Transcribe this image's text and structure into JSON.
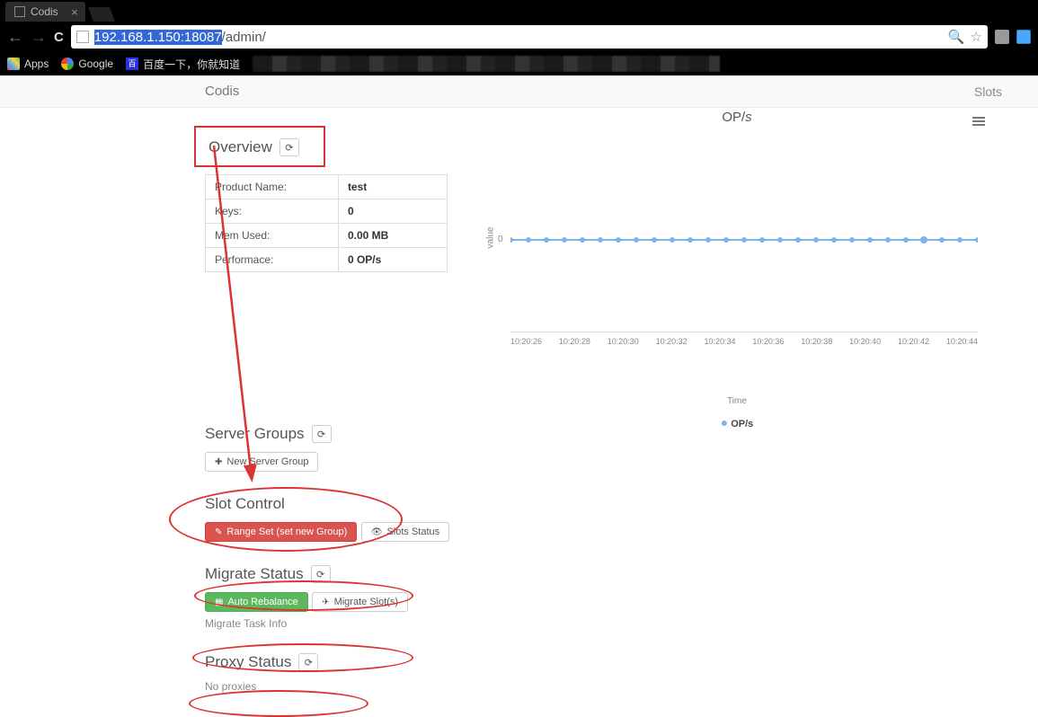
{
  "browser": {
    "tab_title": "Codis",
    "url_selected": "192.168.1.150:18087",
    "url_rest": "/admin/",
    "bookmarks": {
      "apps": "Apps",
      "google": "Google",
      "baidu": "百度一下，你就知道"
    }
  },
  "nav": {
    "brand": "Codis",
    "slots": "Slots"
  },
  "overview": {
    "title": "Overview",
    "rows": [
      {
        "label": "Product Name:",
        "value": "test"
      },
      {
        "label": "Keys:",
        "value": "0"
      },
      {
        "label": "Mem Used:",
        "value": "0.00 MB"
      },
      {
        "label": "Performace:",
        "value": "0 OP/s"
      }
    ]
  },
  "server_groups": {
    "title": "Server Groups",
    "new_btn": "New Server Group"
  },
  "slot_control": {
    "title": "Slot Control",
    "range_set": "Range Set (set new Group)",
    "slots_status": "Slots Status"
  },
  "migrate": {
    "title": "Migrate Status",
    "auto": "Auto Rebalance",
    "migrate": "Migrate Slot(s)",
    "task_info": "Migrate Task Info"
  },
  "proxy": {
    "title": "Proxy Status",
    "none": "No proxies"
  },
  "chart": {
    "title_pre": "OP",
    "title_post": "s",
    "xlabel": "Time",
    "legend": "OP/s"
  },
  "chart_data": {
    "type": "line",
    "title": "OP/s",
    "xlabel": "Time",
    "ylabel": "value",
    "ylim": [
      0,
      0
    ],
    "x": [
      "10:20:26",
      "10:20:28",
      "10:20:30",
      "10:20:32",
      "10:20:34",
      "10:20:36",
      "10:20:38",
      "10:20:40",
      "10:20:42",
      "10:20:44"
    ],
    "series": [
      {
        "name": "OP/s",
        "values": [
          0,
          0,
          0,
          0,
          0,
          0,
          0,
          0,
          0,
          0,
          0,
          0,
          0,
          0,
          0,
          0,
          0,
          0,
          0,
          0,
          0,
          0,
          0,
          0,
          0,
          0
        ]
      }
    ]
  }
}
